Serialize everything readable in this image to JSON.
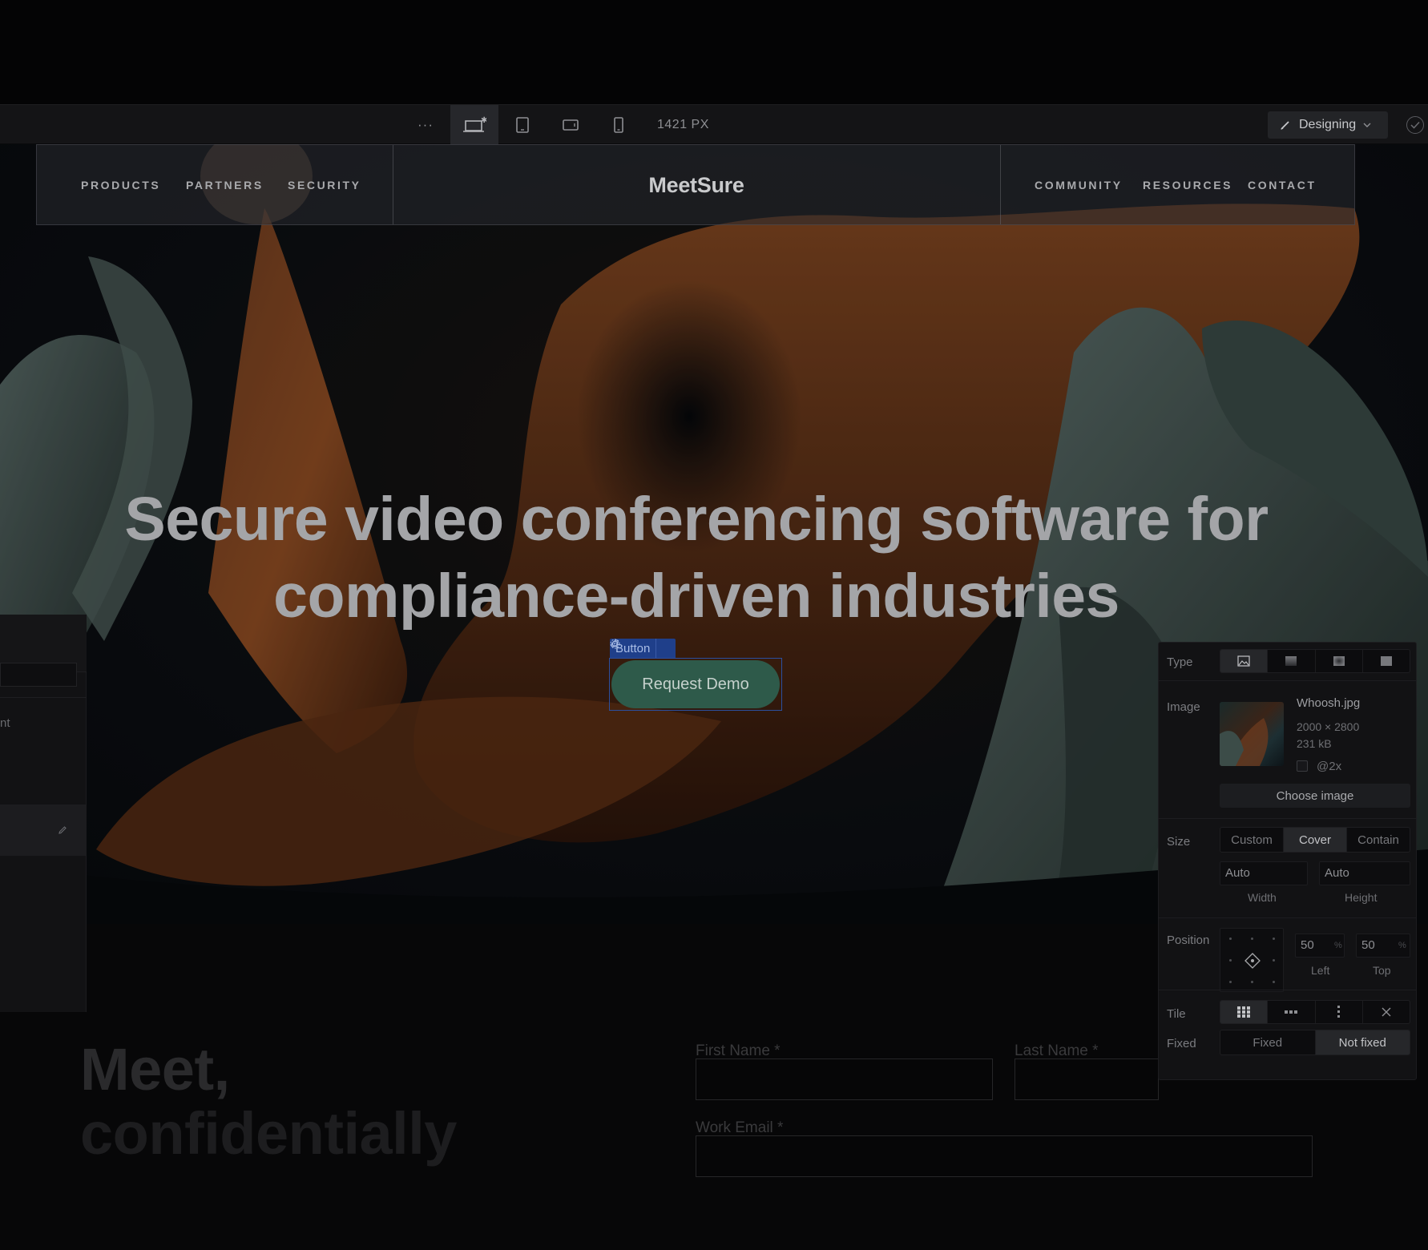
{
  "toolbar": {
    "more_label": "···",
    "canvas_width": "1421 PX",
    "mode_label": "Designing"
  },
  "site": {
    "nav_left": [
      "PRODUCTS",
      "PARTNERS",
      "SECURITY"
    ],
    "brand": "MeetSure",
    "nav_right": [
      "COMMUNITY",
      "RESOURCES",
      "CONTACT"
    ],
    "headline_line1": "Secure video conferencing software for",
    "headline_line2": "compliance-driven industries",
    "cta_label": "Request Demo",
    "selection_tag": "Button",
    "section_title_line1": "Meet,",
    "section_title_line2": "confidentially",
    "form": {
      "first_name_label": "First Name *",
      "last_name_label": "Last Name  *",
      "work_email_label": "Work Email *"
    }
  },
  "left_panel": {
    "partial_text": "nt"
  },
  "style_panel": {
    "type_label": "Type",
    "image_label": "Image",
    "file_name": "Whoosh.jpg",
    "dimensions": "2000 × 2800",
    "file_size": "231 kB",
    "retina_label": "@2x",
    "choose_image": "Choose image",
    "size_label": "Size",
    "size_options": [
      "Custom",
      "Cover",
      "Contain"
    ],
    "size_selected": "Cover",
    "width_value": "Auto",
    "height_value": "Auto",
    "width_caption": "Width",
    "height_caption": "Height",
    "position_label": "Position",
    "left_value": "50",
    "top_value": "50",
    "percent_unit": "%",
    "left_caption": "Left",
    "top_caption": "Top",
    "tile_label": "Tile",
    "fixed_label": "Fixed",
    "fixed_options": [
      "Fixed",
      "Not fixed"
    ],
    "fixed_selected": "Not fixed"
  },
  "colors": {
    "cta_fill": "#2e5a4a",
    "selection_blue": "#1f3f8a",
    "copper": "#8a4a22",
    "sage": "#4a5c58"
  },
  "icons": {
    "toolbar": [
      "desktop-star-icon",
      "tablet-icon",
      "mobile-landscape-icon",
      "mobile-portrait-icon",
      "brush-icon",
      "chevron-down-icon",
      "check-circle-icon"
    ],
    "style_panel": [
      "image-icon",
      "linear-gradient-icon",
      "radial-gradient-icon",
      "solid-color-icon",
      "tile-grid-icon",
      "tile-horizontal-icon",
      "tile-vertical-icon",
      "no-tile-icon",
      "position-target-icon"
    ]
  }
}
